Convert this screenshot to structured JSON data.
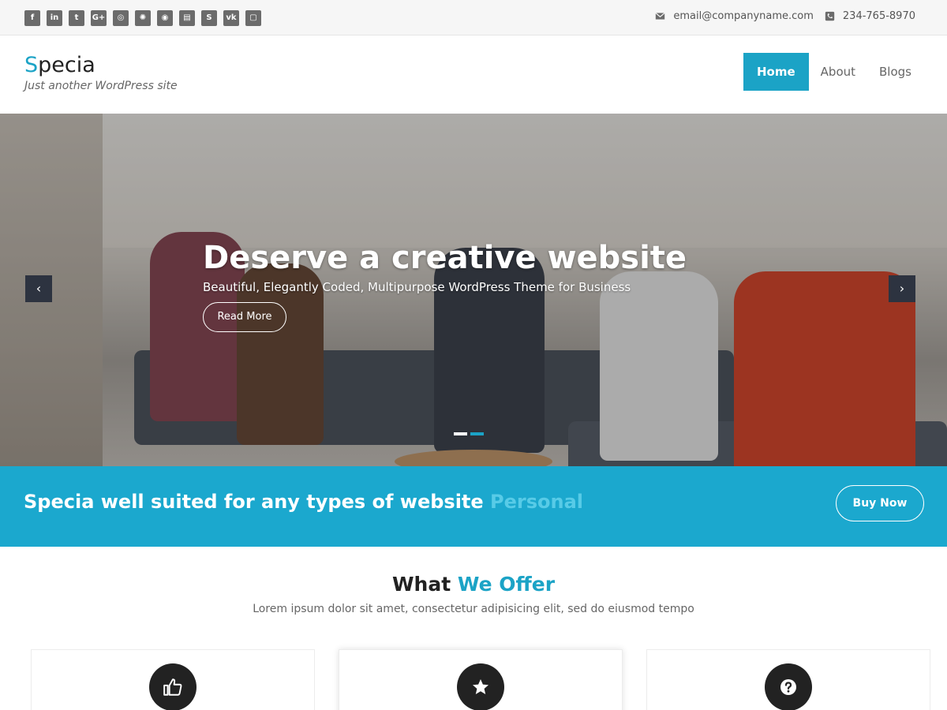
{
  "topbar": {
    "social_icons": [
      "facebook-icon",
      "linkedin-icon",
      "twitter-icon",
      "google-plus-icon",
      "instagram-icon",
      "dribbble-icon",
      "github-icon",
      "foursquare-icon",
      "skype-icon",
      "vk-icon",
      "flickr-icon"
    ],
    "social_glyphs": [
      "f",
      "in",
      "t",
      "G+",
      "◎",
      "✺",
      "◉",
      "▤",
      "S",
      "vk",
      "▢"
    ],
    "email": "email@companyname.com",
    "phone": "234-765-8970"
  },
  "header": {
    "logo_first": "S",
    "logo_rest": "pecia",
    "tagline": "Just another WordPress site",
    "nav": [
      "Home",
      "About",
      "Blogs"
    ],
    "active_nav": "Home"
  },
  "hero": {
    "title": "Deserve a creative website",
    "subtitle": "Beautiful, Elegantly Coded, Multipurpose WordPress Theme for Business",
    "button": "Read More",
    "prev_arrow": "‹",
    "next_arrow": "›",
    "slides": 2,
    "active_slide": 2
  },
  "cta": {
    "text": "Specia well suited for any types of website",
    "highlight": "Personal",
    "button": "Buy Now"
  },
  "offer": {
    "title_main": "What",
    "title_highlight": "We Offer",
    "subtitle": "Lorem ipsum dolor sit amet, consectetur adipisicing elit, sed do eiusmod tempo",
    "cards": [
      {
        "icon": "thumbs-up-icon"
      },
      {
        "icon": "star-icon"
      },
      {
        "icon": "question-icon"
      }
    ]
  },
  "colors": {
    "accent": "#1ba3c6",
    "cta_band": "#1ba8ce",
    "dark": "#222222"
  }
}
